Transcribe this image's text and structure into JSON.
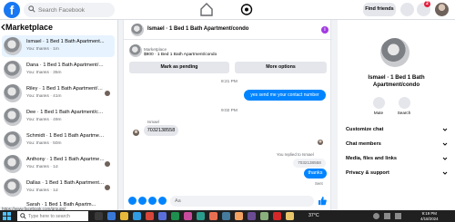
{
  "topbar": {
    "logo": "f",
    "search_placeholder": "Search Facebook",
    "find_friends": "Find friends",
    "notification_count": "2"
  },
  "left_panel": {
    "title": "Marketplace",
    "conversations": [
      {
        "name": "Ismael · 1 Bed 1 Bath Apartment...",
        "preview": "You: thanks · 1m",
        "active": true
      },
      {
        "name": "Dana · 1 Bed 1 Bath Apartment/co...",
        "preview": "You: thanks · 35m"
      },
      {
        "name": "Riley · 1 Bed 1 Bath Apartment/co...",
        "preview": "You: thanks · 41m"
      },
      {
        "name": "Dee · 1 Bed 1 Bath Apartment/condo",
        "preview": "You: thanks · 49m"
      },
      {
        "name": "Schmidt · 1 Bed 1 Bath Apartment...",
        "preview": "You: thanks · 50m"
      },
      {
        "name": "Anthony · 1 Bed 1 Bath Apartment...",
        "preview": "You: thanks · 1d"
      },
      {
        "name": "Dallas · 1 Bed 1 Bath Apartment/c...",
        "preview": "You: thanks · 1d"
      },
      {
        "name": "Sarah · 1 Bed 1 Bath Apartm...",
        "preview": ""
      }
    ]
  },
  "chat": {
    "title": "Ismael · 1 Bed 1 Bath Apartment/condo",
    "info_glyph": "i",
    "marketplace_label": "Marketplace",
    "listing": "$900 · 1 Bed 1 Bath Apartment/condo",
    "mark_pending": "Mark as pending",
    "more_options": "More options",
    "time_1": "8:21 PM",
    "message_out_1": "yes send me your contact number",
    "time_2": "9:02 PM",
    "sender_name": "Ismael",
    "message_in_1": "7032138558",
    "reply_note": "You replied to Ismael",
    "quoted_text": "7032138558",
    "message_out_2": "thanks",
    "sent_label": "Sent",
    "composer_placeholder": "Aa"
  },
  "right_panel": {
    "name": "Ismael · 1 Bed 1 Bath Apartment/condo",
    "mute": "Mute",
    "search": "Search",
    "sections": [
      "Customize chat",
      "Chat members",
      "Media, files and links",
      "Privacy & support"
    ]
  },
  "status": {
    "url": "https://www.facebook.com/groups/",
    "task_search": "Type here to search",
    "weather": "37°C",
    "time": "9:19 PM",
    "date": "4/18/2024"
  },
  "colors": {
    "accent": "#0084ff",
    "brand": "#1877f2",
    "info_purple": "#a33be3"
  }
}
